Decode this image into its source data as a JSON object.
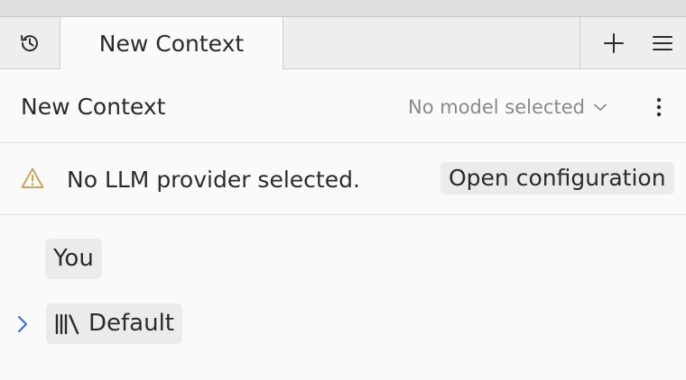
{
  "tabs": {
    "active_label": "New Context"
  },
  "header": {
    "title": "New Context",
    "model_select_value": "No model selected"
  },
  "warning": {
    "text": "No LLM provider selected.",
    "button_label": "Open configuration"
  },
  "conversation": {
    "role_label": "You",
    "section_label": "Default"
  },
  "icons": {
    "history": "history-icon",
    "plus": "plus-icon",
    "menu": "hamburger-menu-icon",
    "chevron": "chevron-down-icon",
    "kebab": "kebab-menu-icon",
    "warning": "warning-triangle-icon",
    "expand": "chevron-right-icon",
    "library": "library-icon"
  },
  "colors": {
    "warning_icon": "#c9a55a",
    "chevron_accent": "#3b6fd8"
  }
}
